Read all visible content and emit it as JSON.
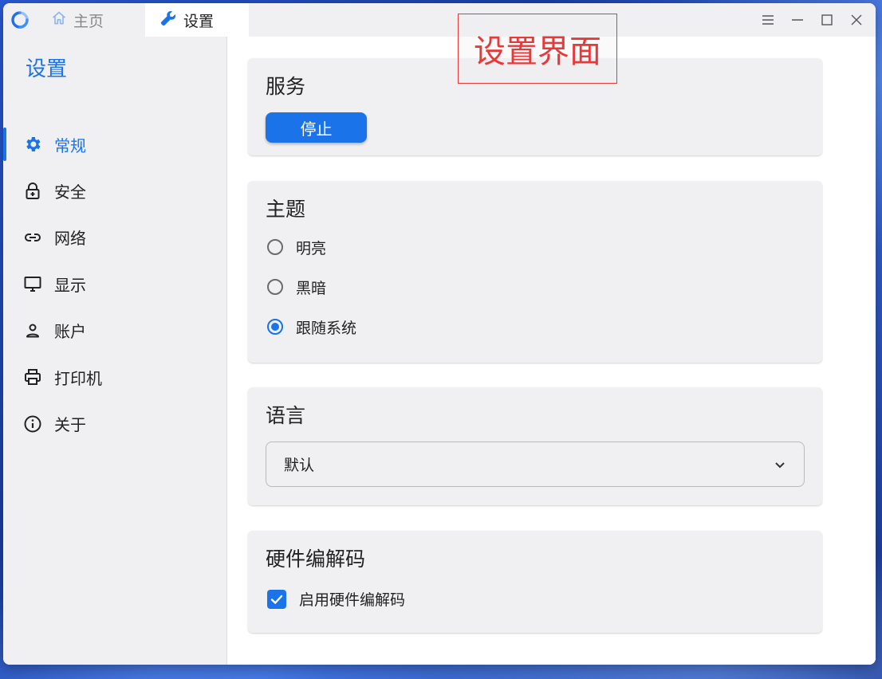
{
  "titlebar": {
    "tabs": [
      {
        "label": "主页",
        "icon": "home-icon",
        "active": false
      },
      {
        "label": "设置",
        "icon": "wrench-icon",
        "active": true
      }
    ],
    "controls": [
      "menu-icon",
      "minimize-icon",
      "maximize-icon",
      "close-icon"
    ]
  },
  "annotation": {
    "text": "设置界面",
    "color": "#e63a3a"
  },
  "sidebar": {
    "title": "设置",
    "items": [
      {
        "label": "常规",
        "icon": "gear-icon",
        "active": true
      },
      {
        "label": "安全",
        "icon": "lock-icon",
        "active": false
      },
      {
        "label": "网络",
        "icon": "link-icon",
        "active": false
      },
      {
        "label": "显示",
        "icon": "monitor-icon",
        "active": false
      },
      {
        "label": "账户",
        "icon": "user-icon",
        "active": false
      },
      {
        "label": "打印机",
        "icon": "printer-icon",
        "active": false
      },
      {
        "label": "关于",
        "icon": "info-icon",
        "active": false
      }
    ]
  },
  "service": {
    "title": "服务",
    "button_label": "停止"
  },
  "theme": {
    "title": "主题",
    "options": [
      {
        "label": "明亮",
        "checked": false
      },
      {
        "label": "黑暗",
        "checked": false
      },
      {
        "label": "跟随系统",
        "checked": true
      }
    ]
  },
  "language": {
    "title": "语言",
    "selected": "默认"
  },
  "hardware_codec": {
    "title": "硬件编解码",
    "checkbox_label": "启用硬件编解码",
    "checked": true
  },
  "colors": {
    "accent": "#1a73e8",
    "panel": "#f0f0f2",
    "annotation": "#e63a3a"
  }
}
